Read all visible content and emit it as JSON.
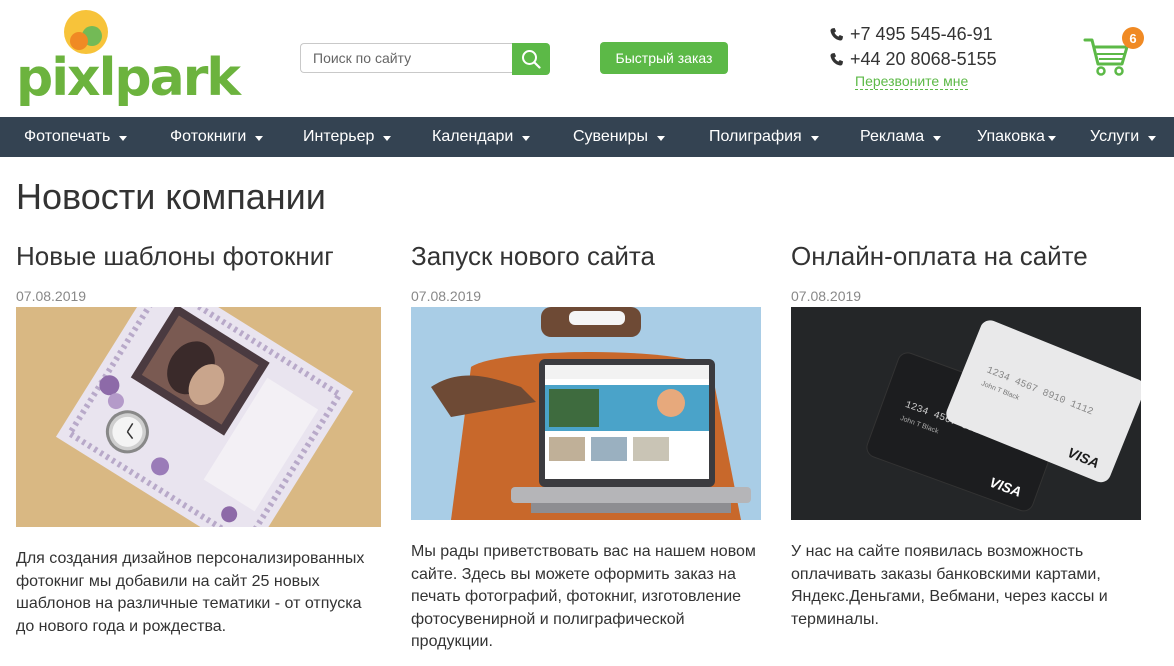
{
  "header": {
    "logo_text": "pixlpark",
    "search": {
      "placeholder": "Поиск по сайту",
      "icon": "search-icon"
    },
    "quick_order_label": "Быстрый заказ",
    "phones": [
      "+7 495 545-46-91",
      "+44 20 8068-5155"
    ],
    "callback_label": "Перезвоните мне",
    "cart_count": "6",
    "colors": {
      "brand_green": "#5cb947",
      "accent_orange": "#f08a24",
      "nav_bg": "#344352"
    }
  },
  "nav": {
    "items": [
      {
        "label": "Фотопечать"
      },
      {
        "label": "Фотокниги"
      },
      {
        "label": "Интерьер"
      },
      {
        "label": "Календари"
      },
      {
        "label": "Сувениры"
      },
      {
        "label": "Полиграфия"
      },
      {
        "label": "Реклама"
      },
      {
        "label": "Упаковка"
      },
      {
        "label": "Услуги"
      }
    ]
  },
  "page": {
    "title": "Новости компании"
  },
  "news": [
    {
      "title": "Новые шаблоны фотокниг",
      "date": "07.08.2019",
      "text": "Для создания дизайнов персонализированных фотокниг мы добавили на сайт 25 новых шаблонов на различные тематики - от отпуска до нового года и рождества."
    },
    {
      "title": "Запуск нового сайта",
      "date": "07.08.2019",
      "text": "Мы рады приветствовать вас на нашем новом сайте. Здесь вы можете оформить заказ на печать фотографий, фотокниг, изготовление фотосувенирной и полиграфической продукции."
    },
    {
      "title": "Онлайн-оплата на сайте",
      "date": "07.08.2019",
      "text": "У нас на сайте появилась возможность оплачивать заказы банковскими картами, Яндекс.Деньгами, Вебмани, через кассы и терминалы."
    },
    {
      "card_text": {
        "number": "1234 4567 8910 1112",
        "holder": "John T Black",
        "brand": "VISA"
      }
    }
  ]
}
